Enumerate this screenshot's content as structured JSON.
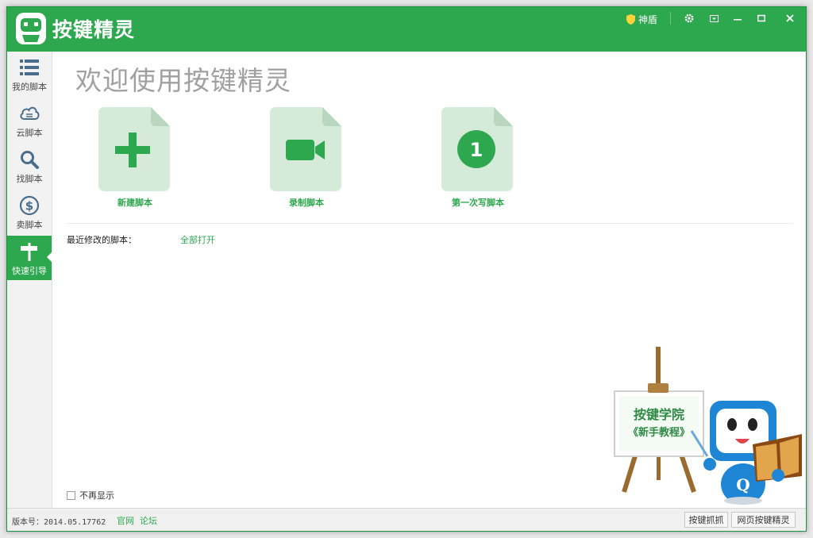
{
  "app": {
    "title": "按键精灵"
  },
  "titlebar": {
    "shield_label": "神盾"
  },
  "sidebar": {
    "items": [
      {
        "label": "我的脚本",
        "icon": "list-icon"
      },
      {
        "label": "云脚本",
        "icon": "cloud-icon"
      },
      {
        "label": "找脚本",
        "icon": "search-icon"
      },
      {
        "label": "卖脚本",
        "icon": "dollar-icon"
      },
      {
        "label": "快速引导",
        "icon": "signpost-icon",
        "active": true
      }
    ]
  },
  "main": {
    "welcome": "欢迎使用按键精灵",
    "actions": [
      {
        "label": "新建脚本",
        "icon": "plus-icon"
      },
      {
        "label": "录制脚本",
        "icon": "video-camera-icon"
      },
      {
        "label": "第一次写脚本",
        "icon": "number-one-icon",
        "number": "1"
      }
    ],
    "recent_label": "最近修改的脚本：",
    "open_all": "全部打开",
    "dont_show": "不再显示",
    "promo": {
      "line1": "按键学院",
      "line2": "《新手教程》",
      "badge": "Q"
    }
  },
  "statusbar": {
    "version": "版本号：2014.05.17762",
    "links": [
      "官网",
      "论坛"
    ],
    "buttons": [
      "按键抓抓",
      "网页按键精灵"
    ]
  },
  "colors": {
    "brand": "#2ea84f",
    "tile_bg": "#d6ead9"
  }
}
